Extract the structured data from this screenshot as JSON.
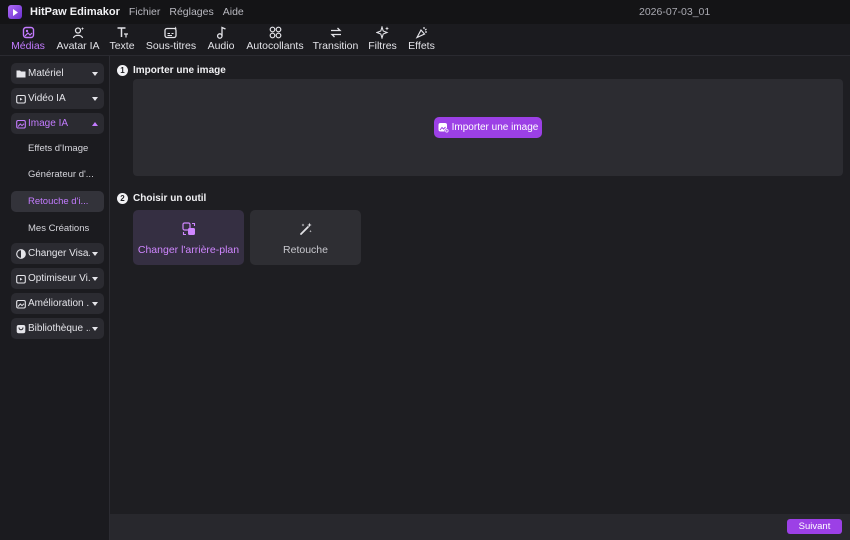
{
  "app": {
    "name": "HitPaw Edimakor",
    "menu": [
      "Fichier",
      "Réglages",
      "Aide"
    ],
    "project_name": "2026-07-03_01"
  },
  "toolbar": {
    "tabs": [
      {
        "label": "Médias",
        "icon": "media-icon",
        "active": true
      },
      {
        "label": "Avatar IA",
        "icon": "avatar-icon"
      },
      {
        "label": "Texte",
        "icon": "text-icon"
      },
      {
        "label": "Sous-titres",
        "icon": "subtitles-icon"
      },
      {
        "label": "Audio",
        "icon": "audio-icon"
      },
      {
        "label": "Autocollants",
        "icon": "stickers-icon"
      },
      {
        "label": "Transition",
        "icon": "transition-icon"
      },
      {
        "label": "Filtres",
        "icon": "filters-icon"
      },
      {
        "label": "Effets",
        "icon": "effects-icon"
      }
    ]
  },
  "sidebar": {
    "categories": [
      {
        "label": "Matériel",
        "icon": "folder-icon",
        "expanded": false
      },
      {
        "label": "Vidéo IA",
        "icon": "ai-video-icon",
        "expanded": false
      },
      {
        "label": "Image IA",
        "icon": "ai-image-icon",
        "expanded": true
      },
      {
        "label": "Changer Visa...",
        "icon": "face-swap-icon",
        "expanded": false
      },
      {
        "label": "Optimiseur Vi...",
        "icon": "video-optimizer-icon",
        "expanded": false
      },
      {
        "label": "Amélioration ...",
        "icon": "enhance-icon",
        "expanded": false
      },
      {
        "label": "Bibliothèque ...",
        "icon": "library-icon",
        "expanded": false
      }
    ],
    "subitems": [
      {
        "label": "Effets d'Image"
      },
      {
        "label": "Générateur d'..."
      },
      {
        "label": "Retouche d'i...",
        "selected": true
      },
      {
        "label": "Mes Créations"
      }
    ]
  },
  "main": {
    "step1": {
      "number": "1",
      "title": "Importer une image",
      "button_label": "Importer une image"
    },
    "step2": {
      "number": "2",
      "title": "Choisir un outil",
      "tools": [
        {
          "label": "Changer l'arrière-plan",
          "icon": "background-change-icon",
          "selected": true
        },
        {
          "label": "Retouche",
          "icon": "magic-wand-icon",
          "selected": false
        }
      ]
    }
  },
  "footer": {
    "next_label": "Suivant"
  },
  "colors": {
    "accent": "#9c40e6",
    "accent_text": "#c37bff",
    "background": "#1e1e22",
    "panel": "#2c2c31"
  }
}
